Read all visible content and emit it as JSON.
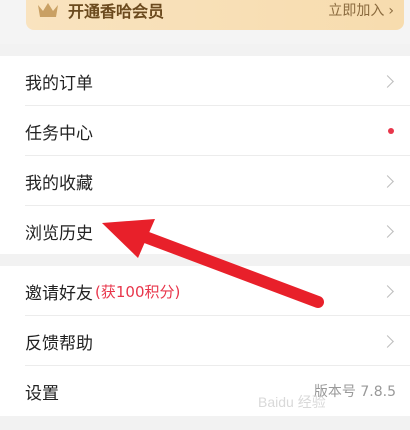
{
  "vip": {
    "title": "开通香哈会员",
    "action": "立即加入",
    "chevron": "›"
  },
  "menu_group_1": [
    {
      "label": "我的订单"
    },
    {
      "label": "任务中心"
    },
    {
      "label": "我的收藏"
    },
    {
      "label": "浏览历史"
    }
  ],
  "menu_group_2": [
    {
      "label": "邀请好友",
      "sub": "(获100积分)"
    },
    {
      "label": "反馈帮助"
    },
    {
      "label": "设置",
      "version": "版本号 7.8.5"
    }
  ],
  "watermark_text": "Baidu 经验",
  "colors": {
    "accent_red": "#e8364b",
    "arrow_red": "#e8202a",
    "vip_bg": "#f9e3bf"
  },
  "icons": {
    "crown": "crown-icon",
    "chevron": "chevron-right-icon"
  }
}
